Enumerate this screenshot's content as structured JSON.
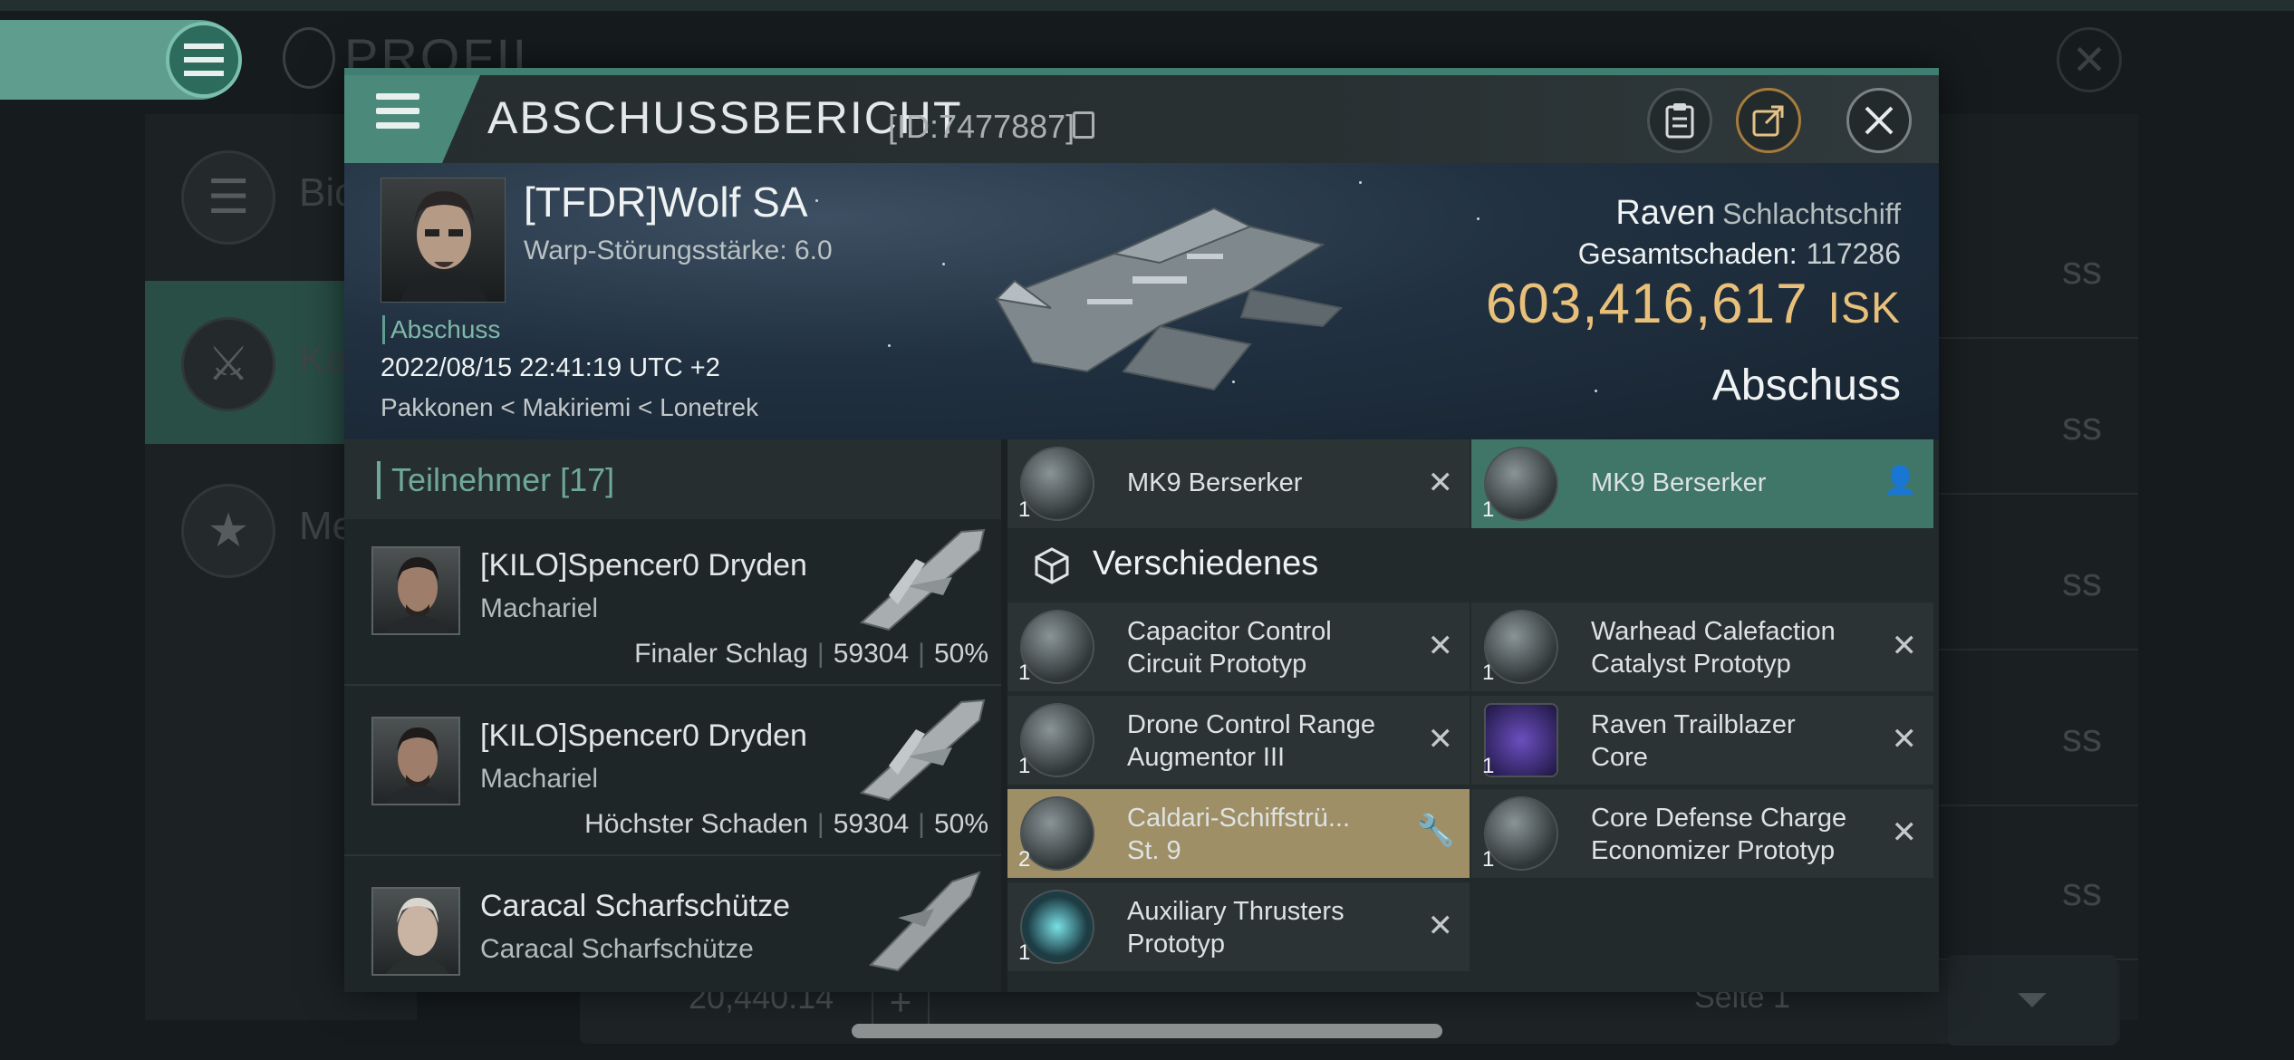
{
  "background": {
    "title": "PROFIL",
    "side_items": [
      "Bio",
      "Ka",
      "Me"
    ],
    "row_suffix": "ss",
    "isk_balance": "20,440.14",
    "page_label": "Seite 1"
  },
  "dialog": {
    "title": "ABSCHUSSBERICHT",
    "id_text": "[ID:7477887]",
    "header_icons": [
      "menu-icon",
      "clipboard-icon",
      "share-icon",
      "close-icon"
    ]
  },
  "victim": {
    "pilot": "[TFDR]Wolf SA",
    "warp": "Warp-Störungsstärke: 6.0",
    "tag": "Abschuss",
    "date": "2022/08/15 22:41:19 UTC +2",
    "location": "Pakkonen < Makiriemi < Lonetrek",
    "ship": "Raven",
    "ship_class": "Schlachtschiff",
    "damage_label": "Gesamtschaden:",
    "damage_value": "117286",
    "isk_value": "603,416,617",
    "isk_unit": "ISK",
    "result": "Abschuss"
  },
  "participants": {
    "header": "Teilnehmer [17]",
    "list": [
      {
        "name": "[KILO]Spencer0 Dryden",
        "ship": "Machariel",
        "role": "Finaler Schlag",
        "damage": "59304",
        "percent": "50%"
      },
      {
        "name": "[KILO]Spencer0 Dryden",
        "ship": "Machariel",
        "role": "Höchster Schaden",
        "damage": "59304",
        "percent": "50%"
      },
      {
        "name": "Caracal Scharfschütze",
        "ship": "Caracal Scharfschütze",
        "role": "",
        "damage": "",
        "percent": ""
      }
    ]
  },
  "items": {
    "drones": [
      {
        "qty": "1",
        "name": "MK9  Berserker"
      },
      {
        "qty": "1",
        "name": "MK9  Berserker"
      }
    ],
    "category": "Verschiedenes",
    "misc": [
      {
        "qty": "1",
        "line1": "Capacitor Control",
        "line2": "Circuit Prototyp"
      },
      {
        "qty": "1",
        "line1": "Warhead Calefaction",
        "line2": "Catalyst Prototyp"
      },
      {
        "qty": "1",
        "line1": "Drone Control Range",
        "line2": "Augmentor III"
      },
      {
        "qty": "1",
        "line1": "Raven Trailblazer",
        "line2": "Core"
      },
      {
        "qty": "2",
        "line1": "Caldari-Schiffstrü...",
        "line2": "St. 9"
      },
      {
        "qty": "1",
        "line1": "Core Defense Charge",
        "line2": "Economizer Prototyp"
      },
      {
        "qty": "1",
        "line1": "Auxiliary Thrusters",
        "line2": "Prototyp"
      }
    ]
  }
}
